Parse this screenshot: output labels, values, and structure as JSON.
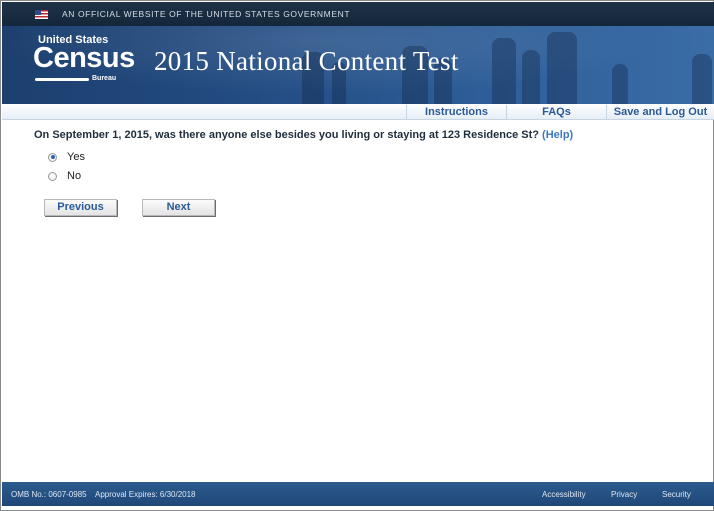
{
  "gov_banner": {
    "text": "AN OFFICIAL WEBSITE OF THE UNITED STATES GOVERNMENT"
  },
  "header": {
    "logo": {
      "top": "United States",
      "main": "Census",
      "bottom": "Bureau"
    },
    "title": "2015 National Content Test"
  },
  "nav": {
    "instructions": "Instructions",
    "faqs": "FAQs",
    "logout": "Save and Log Out"
  },
  "question": {
    "text": "On September 1, 2015, was there anyone else besides you living or staying at 123 Residence St?",
    "help": "(Help)",
    "options": [
      {
        "label": "Yes",
        "selected": true
      },
      {
        "label": "No",
        "selected": false
      }
    ]
  },
  "buttons": {
    "previous": "Previous",
    "next": "Next"
  },
  "footer": {
    "omb": "OMB No.: 0607-0985",
    "expires": "Approval Expires: 6/30/2018",
    "accessibility": "Accessibility",
    "privacy": "Privacy",
    "security": "Security"
  },
  "colors": {
    "header_blue": "#244e85",
    "link_blue": "#2a5a96",
    "help_blue": "#3c78c3",
    "footer_blue": "#2c5a8e"
  }
}
